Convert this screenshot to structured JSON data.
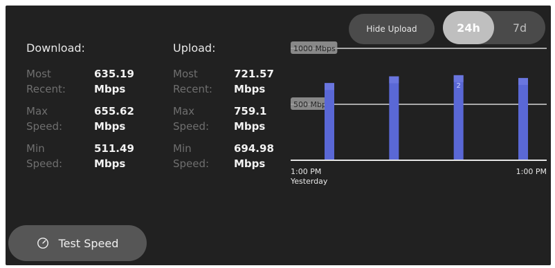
{
  "controls": {
    "hide_upload_label": "Hide Upload",
    "range_options": [
      {
        "label": "24h",
        "selected": true
      },
      {
        "label": "7d",
        "selected": false
      }
    ],
    "test_speed_label": "Test Speed",
    "test_speed_icon": "speedometer-icon"
  },
  "download": {
    "title": "Download:",
    "rows": [
      {
        "label": [
          "Most",
          "Recent:"
        ],
        "value": [
          "635.19",
          "Mbps"
        ]
      },
      {
        "label": [
          "Max",
          "Speed:"
        ],
        "value": [
          "655.62",
          "Mbps"
        ]
      },
      {
        "label": [
          "Min",
          "Speed:"
        ],
        "value": [
          "511.49",
          "Mbps"
        ]
      }
    ]
  },
  "upload": {
    "title": "Upload:",
    "rows": [
      {
        "label": [
          "Most",
          "Recent:"
        ],
        "value": [
          "721.57",
          "Mbps"
        ]
      },
      {
        "label": [
          "Max",
          "Speed:"
        ],
        "value": [
          "759.1",
          "Mbps"
        ]
      },
      {
        "label": [
          "Min",
          "Speed:"
        ],
        "value": [
          "694.98",
          "Mbps"
        ]
      }
    ]
  },
  "chart_data": {
    "type": "bar",
    "y_reference_lines": [
      {
        "value": 1000,
        "label": "1000 Mbps"
      },
      {
        "value": 500,
        "label": "500 Mbps"
      }
    ],
    "ylim": [
      0,
      1000
    ],
    "values": [
      690,
      750,
      760,
      735
    ],
    "bar_labels": [
      "",
      "",
      "2",
      ""
    ],
    "x_tick_labels": {
      "left": [
        "1:00 PM",
        "Yesterday"
      ],
      "right": "1:00 PM"
    },
    "colors": {
      "bar": "#5a68d6",
      "bar_top": "#6b78e0",
      "gridline": "#d8d8d8"
    }
  }
}
